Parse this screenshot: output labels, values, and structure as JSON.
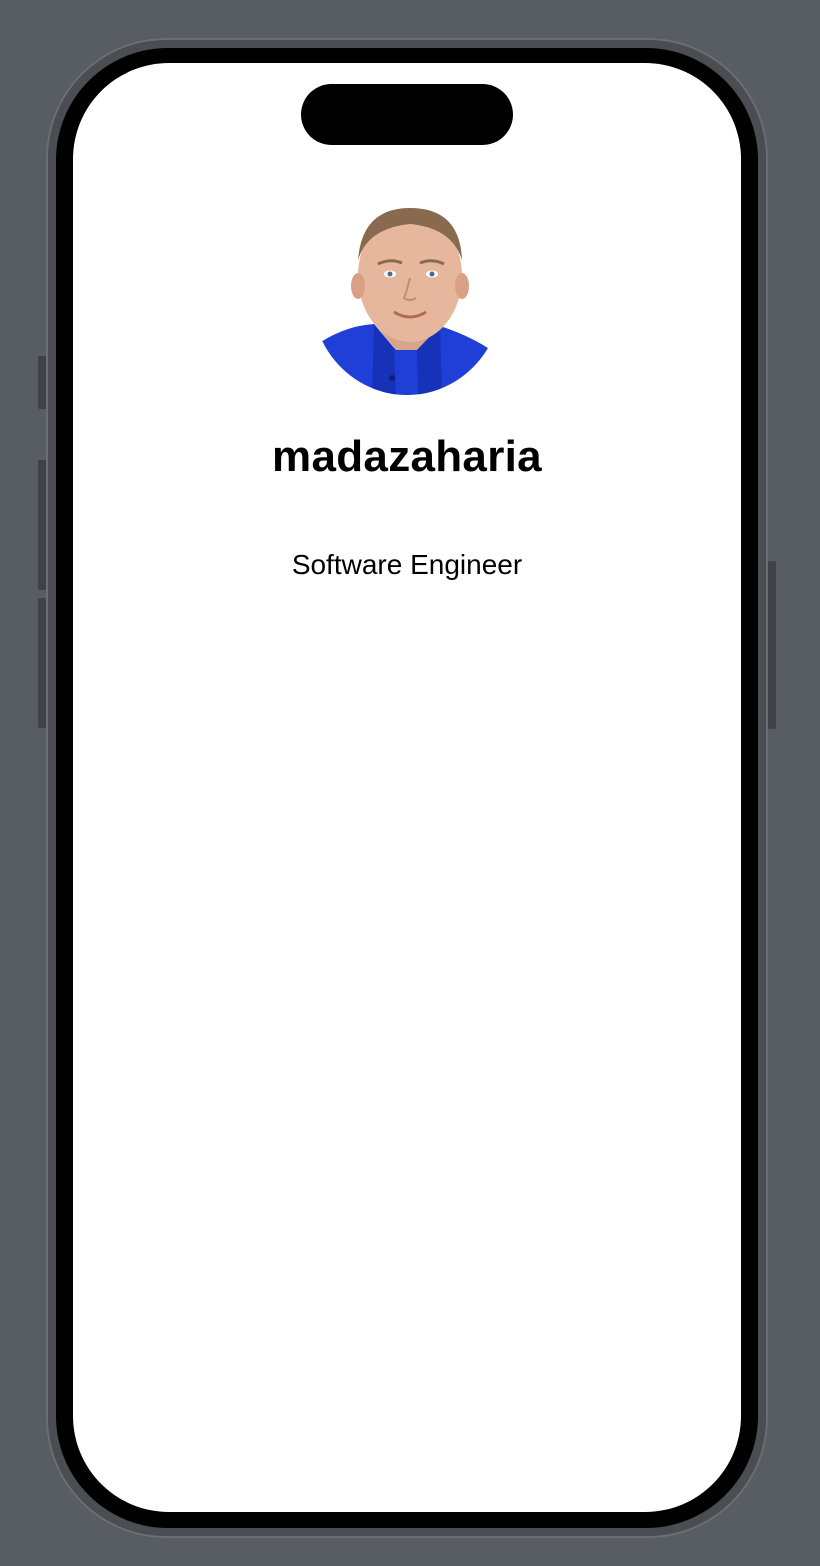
{
  "profile": {
    "username": "madazaharia",
    "job_title": "Software Engineer",
    "avatar_icon": "profile-photo"
  },
  "colors": {
    "background": "#585c63",
    "screen": "#ffffff",
    "text": "#000000",
    "shirt": "#1f3fd6"
  }
}
